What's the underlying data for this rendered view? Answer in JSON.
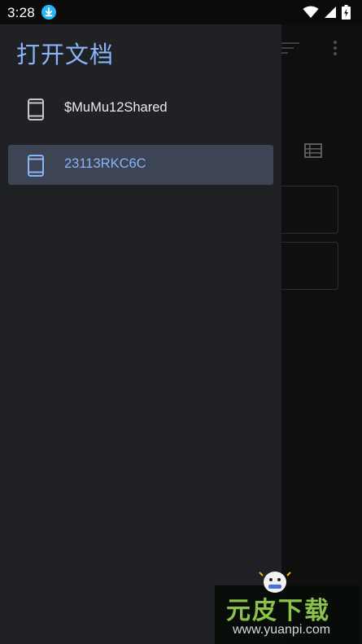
{
  "status_bar": {
    "time": "3:28",
    "icons": [
      "download-icon",
      "wifi-icon",
      "cell-signal-icon",
      "battery-charging-icon"
    ]
  },
  "drawer": {
    "title": "打开文档",
    "items": [
      {
        "label": "$MuMu12Shared",
        "icon": "phone-icon",
        "selected": false
      },
      {
        "label": "23113RKC6C",
        "icon": "phone-icon",
        "selected": true
      }
    ]
  },
  "background_app": {
    "toolbar_icons": [
      "sort-icon",
      "more-vert-icon"
    ],
    "view_icon": "list-view-icon"
  },
  "watermark": {
    "text": "元皮下载",
    "url": "www.yuanpi.com"
  },
  "colors": {
    "accent": "#8ab4f8",
    "drawer_bg": "#202124",
    "selected_bg": "#3d4554",
    "watermark_green": "#8bc34a"
  }
}
